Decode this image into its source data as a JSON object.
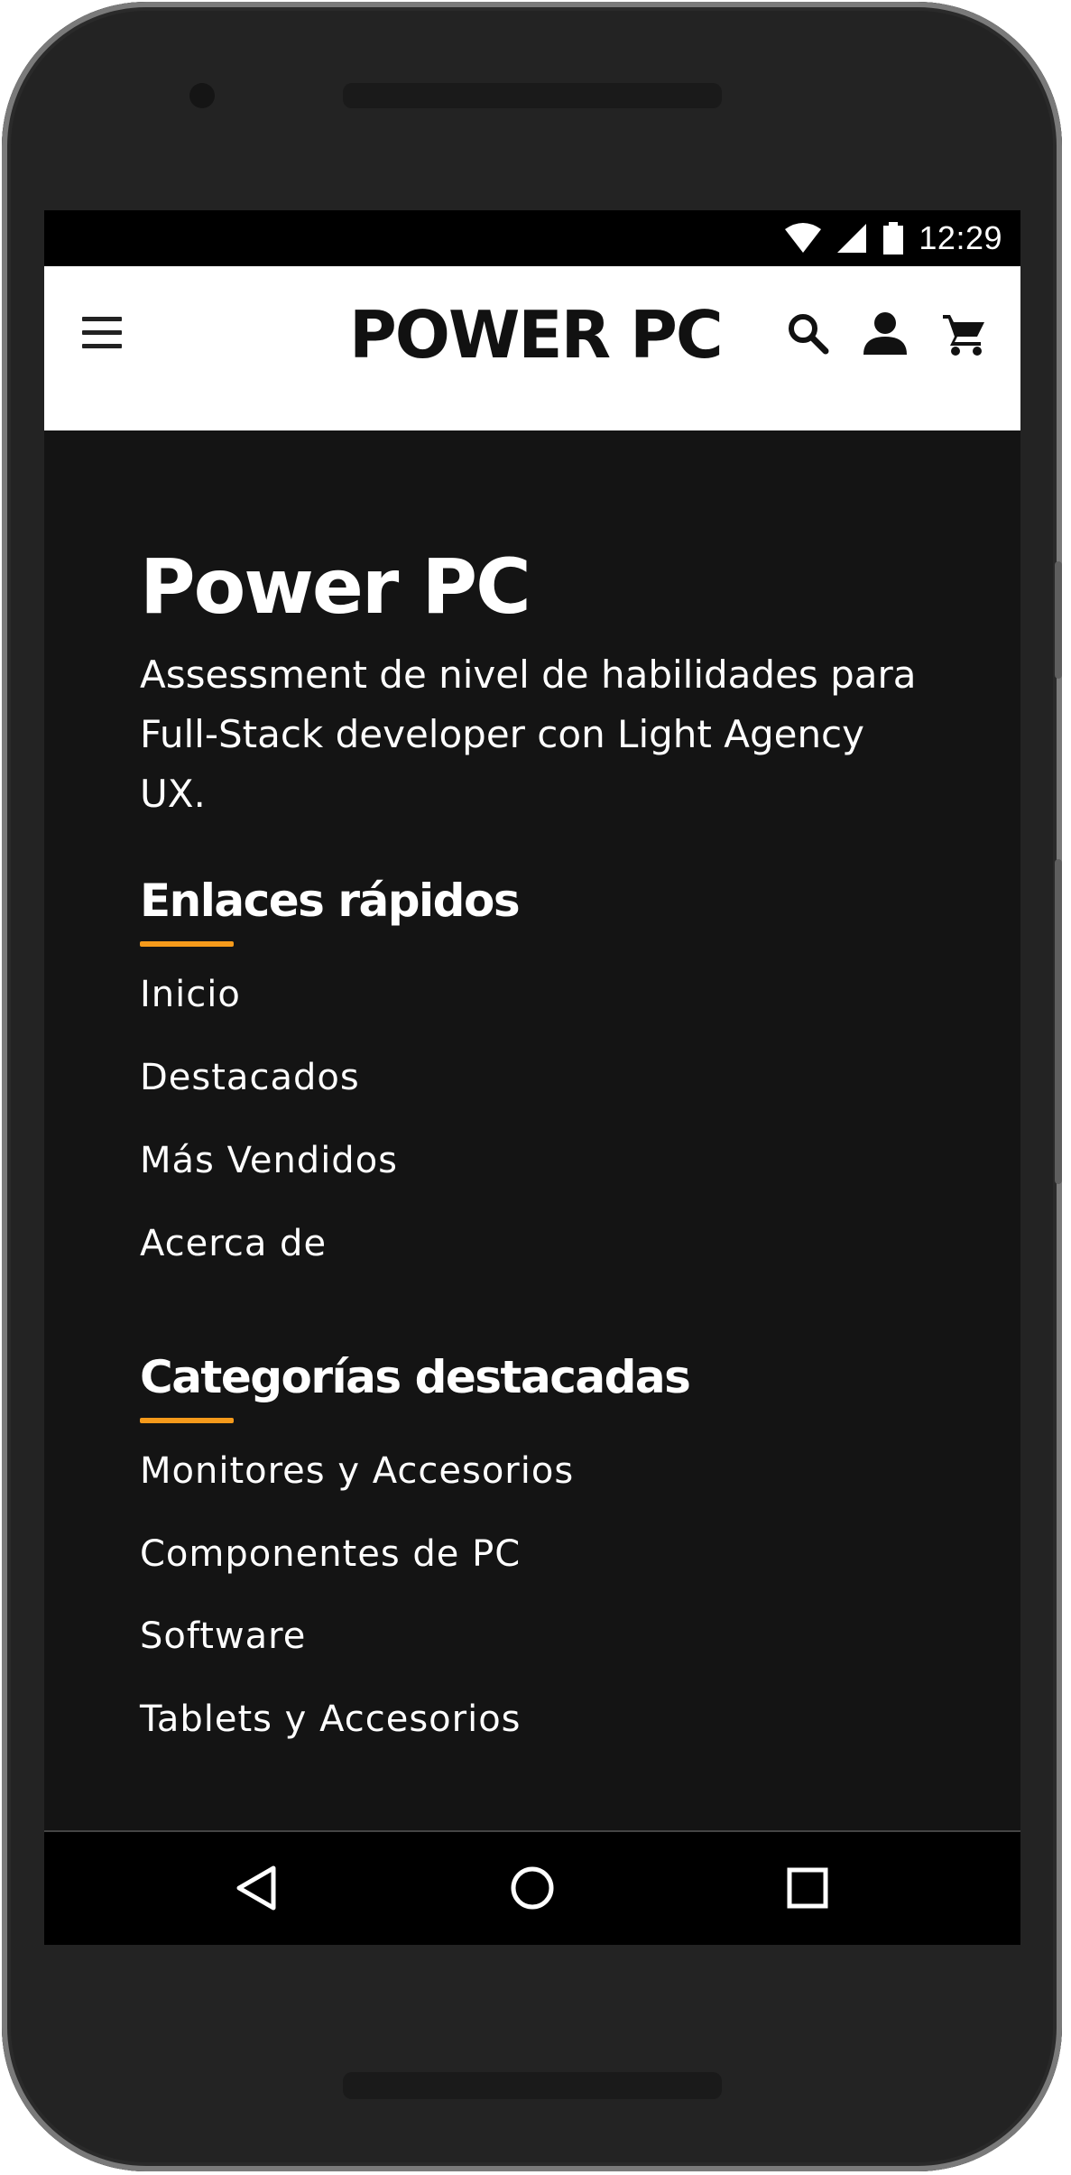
{
  "status_bar": {
    "time": "12:29",
    "icons": [
      "wifi-icon",
      "signal-icon",
      "battery-icon"
    ]
  },
  "header": {
    "menu_icon": "hamburger-menu-icon",
    "logo_text": "POWER PC",
    "actions": [
      "search-icon",
      "account-icon",
      "cart-icon"
    ]
  },
  "footer": {
    "brand_title": "Power PC",
    "description": "Assessment de nivel de habilidades para Full-Stack developer con Light Agency UX.",
    "quick_links": {
      "title": "Enlaces rápidos",
      "items": [
        "Inicio",
        "Destacados",
        "Más Vendidos",
        "Acerca de"
      ]
    },
    "featured_categories": {
      "title": "Categorías destacadas",
      "items": [
        "Monitores y Accesorios",
        "Componentes de PC",
        "Software",
        "Tablets y Accesorios"
      ]
    }
  },
  "nav_bar": {
    "buttons": [
      "back-icon",
      "home-icon",
      "recents-icon"
    ]
  },
  "colors": {
    "accent": "#f59a1b",
    "footer_bg": "#141414",
    "header_bg": "#ffffff",
    "device_frame": "#232323"
  }
}
